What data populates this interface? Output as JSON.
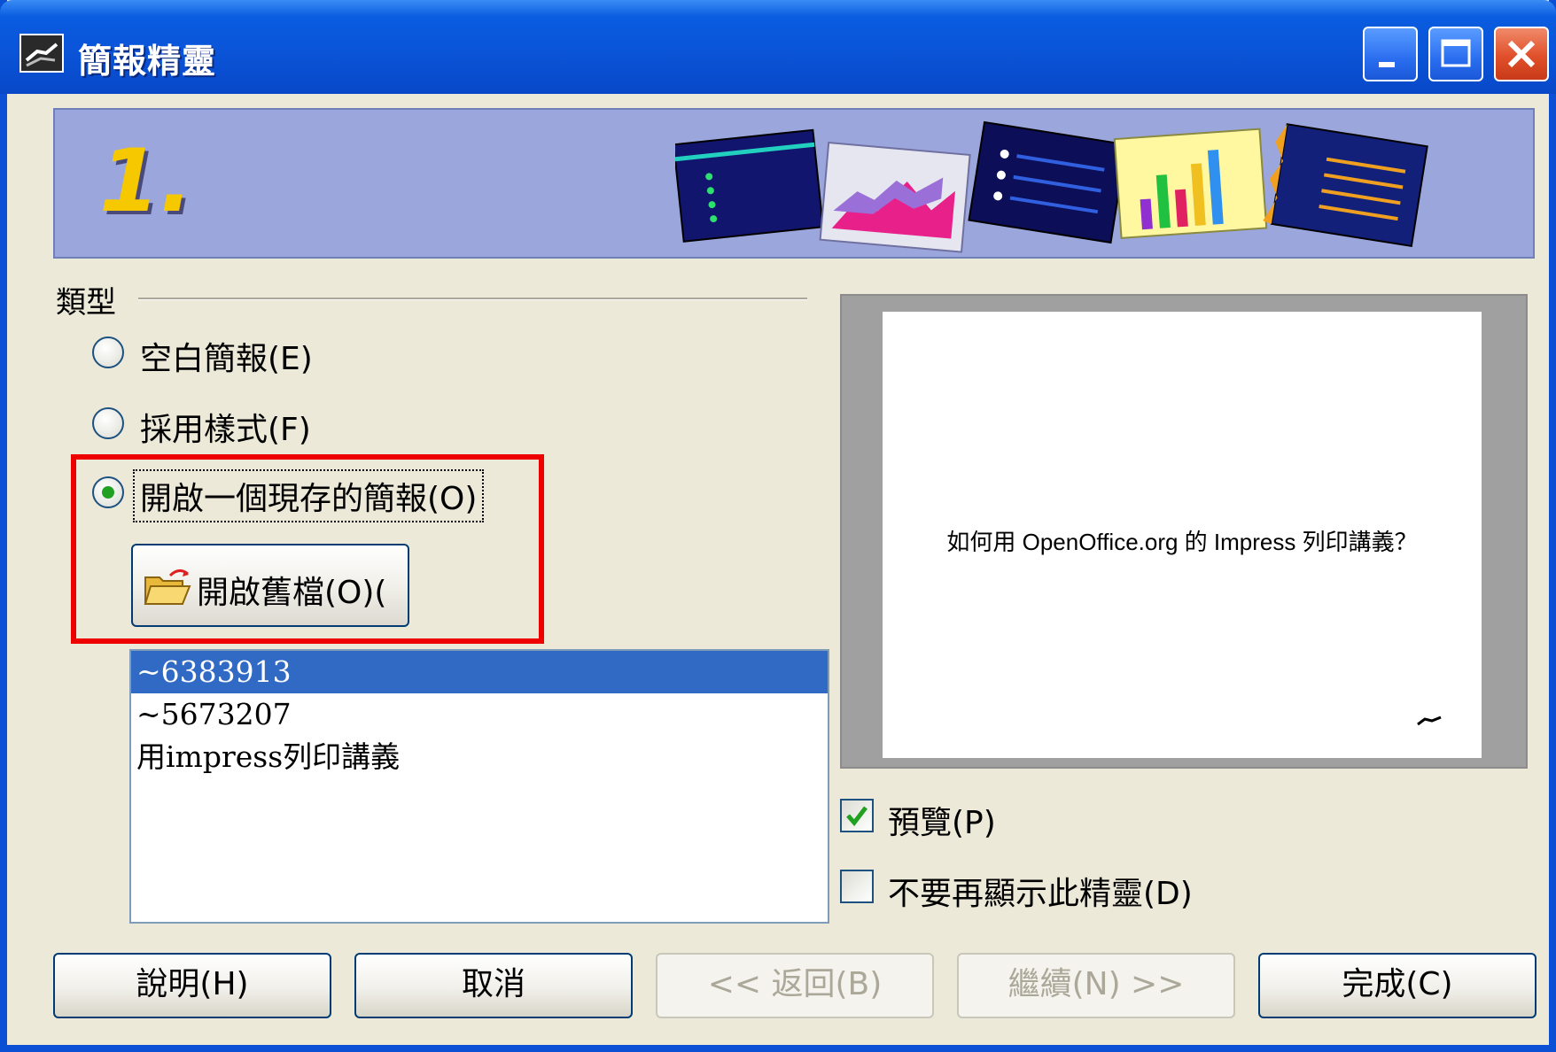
{
  "window": {
    "title": "簡報精靈"
  },
  "banner": {
    "step": "1."
  },
  "type_group": {
    "label": "類型",
    "options": [
      {
        "label": "空白簡報(E)",
        "selected": false
      },
      {
        "label": "採用樣式(F)",
        "selected": false
      },
      {
        "label": "開啟一個現存的簡報(O)",
        "selected": true
      }
    ]
  },
  "open_button": {
    "label": "開啟舊檔(O)("
  },
  "file_list": {
    "items": [
      "~6383913",
      "~5673207",
      "用impress列印講義"
    ],
    "selected_index": 0
  },
  "preview": {
    "slide_text": "如何用 OpenOffice.org 的 Impress 列印講義？"
  },
  "checks": {
    "preview": {
      "label": "預覽(P)",
      "checked": true
    },
    "dont_show": {
      "label": "不要再顯示此精靈(D)",
      "checked": false
    }
  },
  "buttons": {
    "help": "說明(H)",
    "cancel": "取消",
    "back": "<< 返回(B)",
    "next": "繼續(N) >>",
    "finish": "完成(C)"
  },
  "colors": {
    "highlight": "#ee0000",
    "selection": "#316ac5",
    "titlebar": "#0a54d8"
  }
}
